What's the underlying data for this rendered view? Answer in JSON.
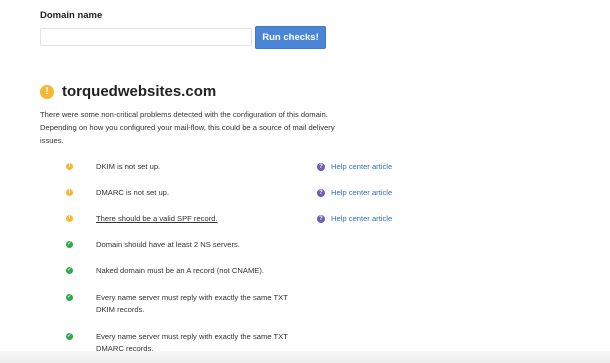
{
  "form": {
    "label": "Domain name",
    "input_value": "",
    "button_label": "Run checks!"
  },
  "result": {
    "domain": "torquedwebsites.com",
    "status_icon": "warning-icon",
    "description": "There were some non-critical problems detected with the configuration of this domain. Depending on how you configured your mail-flow, this could be a source of mail delivery issues."
  },
  "checks": [
    {
      "status": "warning",
      "text": "DKIM is not set up.",
      "help": "Help center article"
    },
    {
      "status": "warning",
      "text": "DMARC is not set up.",
      "help": "Help center article"
    },
    {
      "status": "warning",
      "text": "There should be a valid SPF record.",
      "help": "Help center article"
    },
    {
      "status": "ok",
      "text": "Domain should have at least 2 NS servers."
    },
    {
      "status": "ok",
      "text": "Naked domain must be an A record (not CNAME)."
    },
    {
      "status": "ok",
      "text": "Every name server must reply with exactly the same TXT DKIM records."
    },
    {
      "status": "ok",
      "text": "Every name server must reply with exactly the same TXT DMARC records."
    }
  ],
  "colors": {
    "primary_button": "#4a86d6",
    "warning": "#f4b932",
    "success": "#2ea94b",
    "help_icon": "#6d5bb4",
    "link": "#2f6fc4"
  }
}
